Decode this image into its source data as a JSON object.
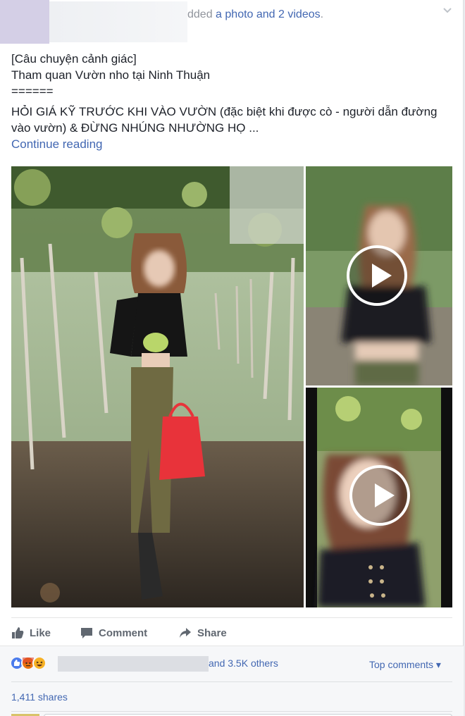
{
  "header": {
    "action_prefix": "dded ",
    "action_link": "a photo and 2 videos",
    "action_suffix": "."
  },
  "post": {
    "lines": [
      "[Câu chuyện cảnh giác]",
      "Tham quan Vườn nho tại Ninh Thuận",
      "======"
    ],
    "warning": "HỎI GIÁ KỸ TRƯỚC KHI VÀO VƯỜN (đặc biệt khi được cò - người dẫn đường vào vườn) & ĐỪNG NHÚNG NHƯỜNG HỌ ...",
    "continue": "Continue reading"
  },
  "actions": {
    "like": "Like",
    "comment": "Comment",
    "share": "Share"
  },
  "reactions": {
    "others": "and 3.5K others",
    "top_comments": "Top comments ▾",
    "shares": "1,411 shares",
    "icons": [
      "like-reaction-icon",
      "angry-reaction-icon",
      "haha-reaction-icon"
    ]
  },
  "colors": {
    "link": "#4267b2",
    "muted": "#90949c",
    "action": "#606770"
  }
}
